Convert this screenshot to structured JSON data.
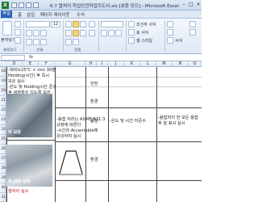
{
  "window": {
    "title": "6.7 열처리 작업안전작업지도서.xls [호환 모드] - Microsoft Excel",
    "app_icon_letter": "X",
    "controls": [
      "–",
      "□",
      "×"
    ]
  },
  "menu": {
    "items": [
      "파일",
      "홈",
      "삽입",
      "페이지 레이아웃",
      "수식"
    ]
  },
  "ribbon": {
    "clipboard": "붙여넣기",
    "font_size": "12",
    "format_label": "서식",
    "group_labels": [
      "클립보드",
      "글꼴",
      "맞춤"
    ],
    "conditional": "조건부 서식",
    "table_format": "표 서식",
    "cell_style": "셀 스타일"
  },
  "formula_bar": {
    "fx": "fx"
  },
  "columns": [
    "D",
    "E",
    "F",
    "G",
    "H",
    "I",
    "J",
    "K",
    "L",
    "M",
    "N",
    "O"
  ],
  "rows": [
    "18",
    "19",
    "20",
    "21",
    "22",
    "23",
    "24",
    "25",
    "26",
    "27",
    "28",
    "29",
    "30",
    "31"
  ],
  "cells": {
    "c1_line1": "-300±25℃ × min 30분",
    "c1_line2": "Holding(시간) 후 즉시",
    "c1_line3": "보온 실시",
    "c1_line4": "-온도 및 Holding시간 준수",
    "c1_line5": "",
    "c1_line6": "후 세정할수 있도록 보온",
    "c1_line7": "실시",
    "c2_line1": "-용접 처리는 ASME B31.3",
    "c2_line2": "규정에 따른다",
    "c2_line3": "-시간과 Accenteble에",
    "c2_line4": "유의하여 실시",
    "safety": "안전",
    "env": "환경",
    "quality": "품질",
    "quality_note": "-온도 및 시간 미준수",
    "quality_note2": "-용접처리 전 모든 용접",
    "quality_note3": "후 잘 표시 실시",
    "photo1_caption": "의 보온",
    "photo2_caption": "후 완료 상태",
    "photo3_caption": "열처리 실시"
  }
}
